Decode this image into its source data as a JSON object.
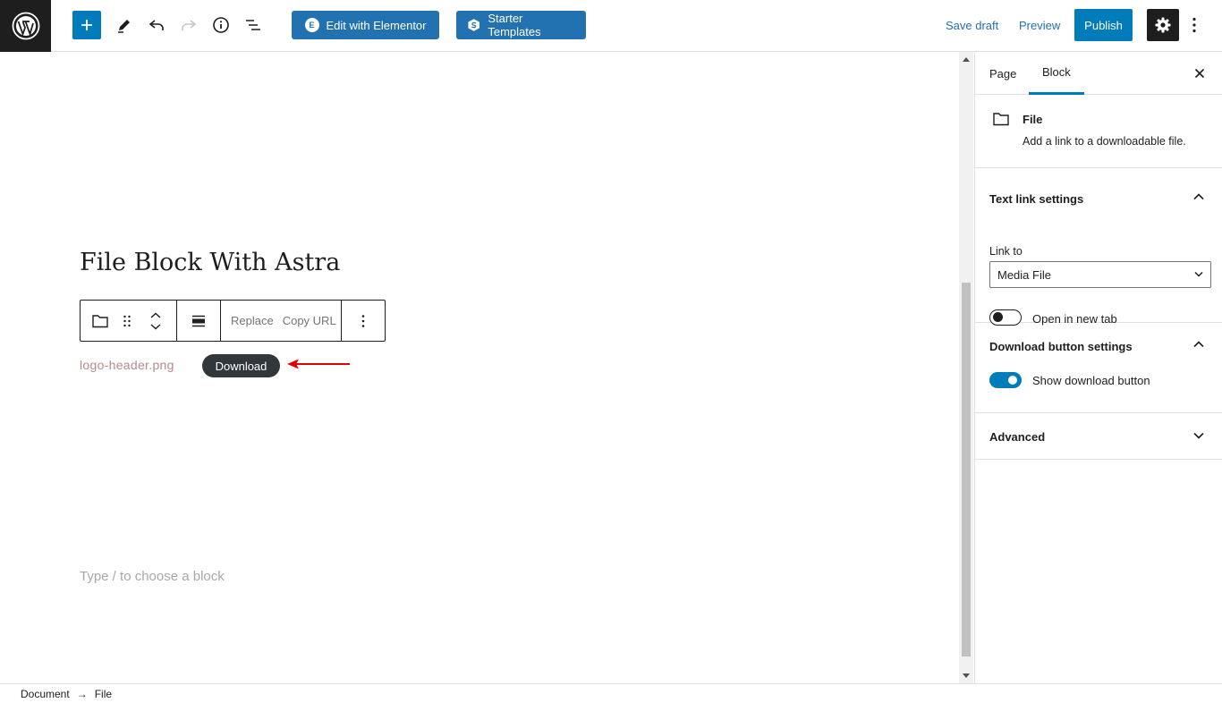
{
  "toolbar": {
    "elementor_label": "Edit with Elementor",
    "elementor_icon_letter": "E",
    "starter_label": "Starter Templates",
    "save_draft": "Save draft",
    "preview": "Preview",
    "publish": "Publish"
  },
  "editor": {
    "title": "File Block With Astra",
    "block_toolbar": {
      "replace": "Replace",
      "copy_url": "Copy URL"
    },
    "file_name": "logo-header.png",
    "download_label": "Download",
    "placeholder": "Type / to choose a block",
    "arrow_color": "#e30000"
  },
  "sidebar": {
    "tabs": [
      {
        "label": "Page",
        "active": false
      },
      {
        "label": "Block",
        "active": true
      }
    ],
    "block_card": {
      "title": "File",
      "description": "Add a link to a downloadable file."
    },
    "text_link_settings": {
      "title": "Text link settings",
      "link_to_label": "Link to",
      "link_to_value": "Media File",
      "open_new_tab_label": "Open in new tab",
      "open_new_tab": false
    },
    "download_button_settings": {
      "title": "Download button settings",
      "show_download_label": "Show download button",
      "show_download": true
    },
    "advanced": {
      "title": "Advanced"
    }
  },
  "footer": {
    "breadcrumb": [
      "Document",
      "File"
    ],
    "separator": "→"
  },
  "colors": {
    "accent": "#007cba",
    "elementor": "#2271b1",
    "dark": "#1e1e1e"
  }
}
